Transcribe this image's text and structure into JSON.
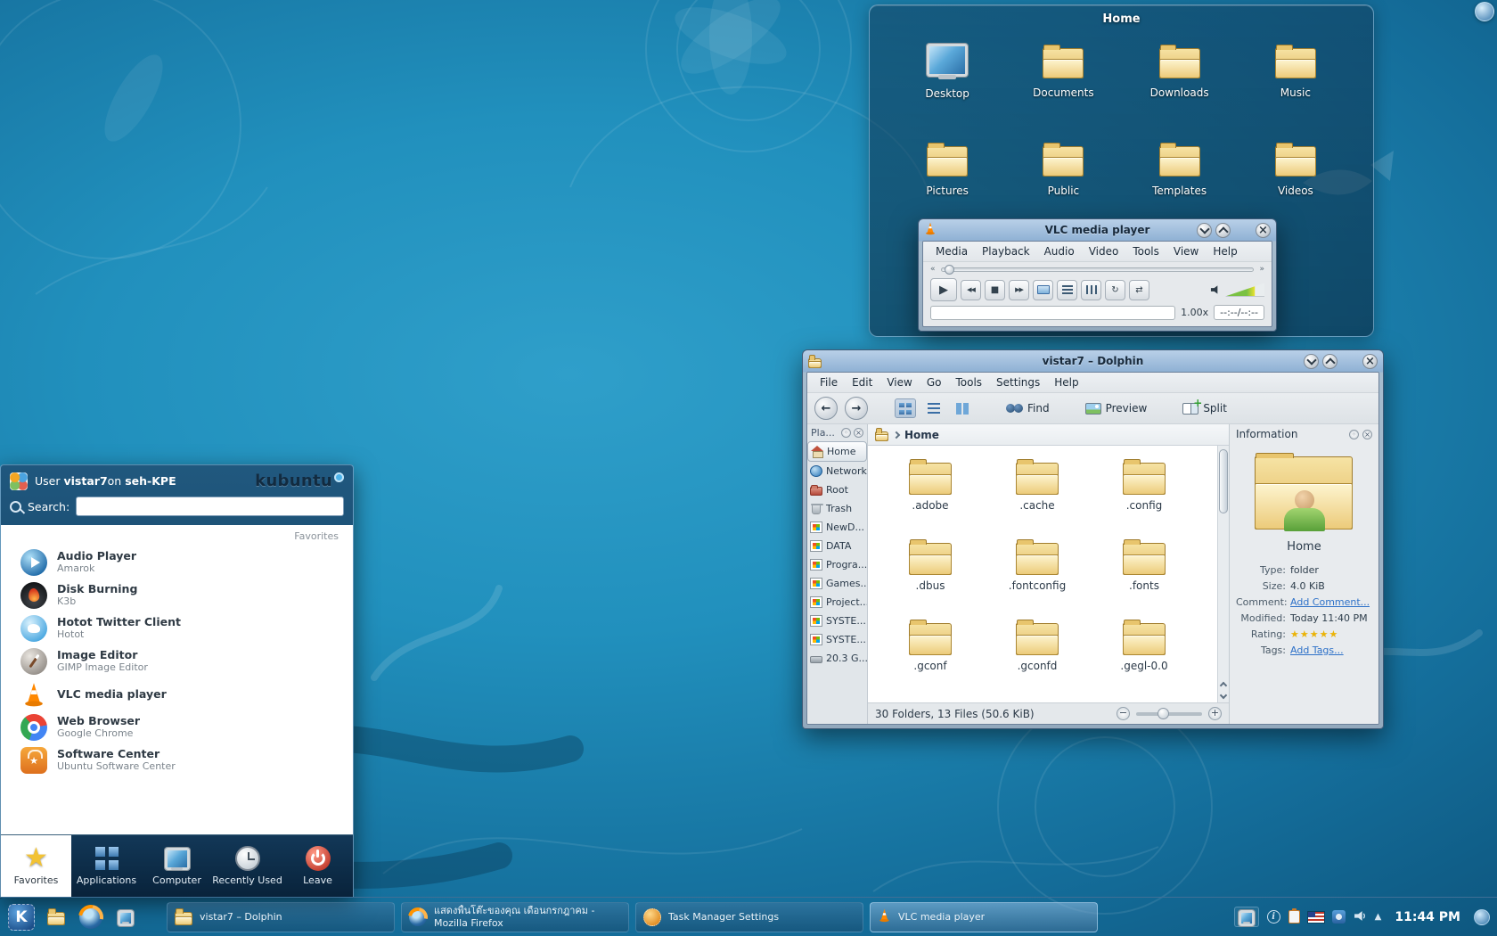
{
  "colors": {
    "wallpaper_center": "#2f9fca",
    "wallpaper_edge": "#073a59",
    "titlebar": "#8fb1d4",
    "folder_icon": "#eccb7a",
    "link": "#2e71c8",
    "rating_star": "#eab308",
    "taskbar": "#0b2740",
    "selection": "#dde4ea",
    "accent": "#3daee9"
  },
  "desktop": {
    "folder_view": {
      "title": "Home",
      "icons": [
        {
          "label": "Desktop"
        },
        {
          "label": "Documents"
        },
        {
          "label": "Downloads"
        },
        {
          "label": "Music"
        },
        {
          "label": "Pictures"
        },
        {
          "label": "Public"
        },
        {
          "label": "Templates"
        },
        {
          "label": "Videos"
        }
      ]
    }
  },
  "vlc": {
    "title": "VLC media player",
    "menus": [
      "Media",
      "Playback",
      "Audio",
      "Video",
      "Tools",
      "View",
      "Help"
    ],
    "rate": "1.00x",
    "time": "--:--/--:--"
  },
  "dolphin": {
    "title": "vistar7 – Dolphin",
    "menus": [
      "File",
      "Edit",
      "View",
      "Go",
      "Tools",
      "Settings",
      "Help"
    ],
    "toolbar": {
      "find": "Find",
      "preview": "Preview",
      "split": "Split"
    },
    "places": {
      "header": "Pla...",
      "items": [
        {
          "label": "Home"
        },
        {
          "label": "Network"
        },
        {
          "label": "Root"
        },
        {
          "label": "Trash"
        },
        {
          "label": "NewD..."
        },
        {
          "label": "DATA"
        },
        {
          "label": "Progra..."
        },
        {
          "label": "Games..."
        },
        {
          "label": "Project..."
        },
        {
          "label": "SYSTE..."
        },
        {
          "label": "SYSTE..."
        },
        {
          "label": "20.3 G..."
        }
      ]
    },
    "breadcrumb": {
      "root": "Home"
    },
    "folders": [
      ".adobe",
      ".cache",
      ".config",
      ".dbus",
      ".fontconfig",
      ".fonts",
      ".gconf",
      ".gconfd",
      ".gegl-0.0"
    ],
    "status": "30 Folders, 13 Files (50.6 KiB)",
    "info": {
      "header": "Information",
      "name": "Home",
      "rows": [
        {
          "label": "Type:",
          "value": "folder"
        },
        {
          "label": "Size:",
          "value": "4.0 KiB"
        },
        {
          "label": "Comment:",
          "value": "Add Comment..."
        },
        {
          "label": "Modified:",
          "value": "Today 11:40 PM"
        },
        {
          "label": "Rating:",
          "value": "★★★★★"
        },
        {
          "label": "Tags:",
          "value": "Add Tags..."
        }
      ]
    }
  },
  "kickoff": {
    "user_prefix": "User",
    "username": "vistar7",
    "conj": "on",
    "hostname": "seh-KPE",
    "brand": "kubuntu",
    "search_label": "Search:",
    "section": "Favorites",
    "favorites": [
      {
        "title": "Audio Player",
        "subtitle": "Amarok"
      },
      {
        "title": "Disk Burning",
        "subtitle": "K3b"
      },
      {
        "title": "Hotot Twitter Client",
        "subtitle": "Hotot"
      },
      {
        "title": "Image Editor",
        "subtitle": "GIMP Image Editor"
      },
      {
        "title": "VLC media player",
        "subtitle": ""
      },
      {
        "title": "Web Browser",
        "subtitle": "Google Chrome"
      },
      {
        "title": "Software Center",
        "subtitle": "Ubuntu Software Center"
      }
    ],
    "tabs": [
      "Favorites",
      "Applications",
      "Computer",
      "Recently Used",
      "Leave"
    ]
  },
  "taskbar": {
    "tasks": [
      {
        "label": "vistar7 – Dolphin"
      },
      {
        "label": "แสดงพื้นโต๊ะของคุณ เดือนกรกฎาคม - Mozilla Firefox"
      },
      {
        "label": "Task Manager Settings"
      },
      {
        "label": "VLC media player"
      }
    ],
    "clock": "11:44 PM"
  }
}
